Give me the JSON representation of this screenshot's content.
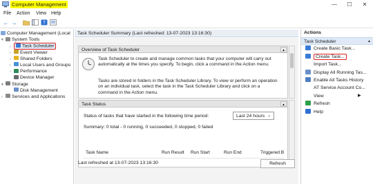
{
  "window": {
    "title": "Computer Management",
    "controls": [
      "—",
      "☐",
      "✕"
    ]
  },
  "menu": [
    "File",
    "Action",
    "View",
    "Help"
  ],
  "tree": {
    "root": "Computer Management (Local",
    "system_tools": "System Tools",
    "items": [
      {
        "label": "Task Scheduler",
        "icon": "task-scheduler-icon",
        "color": "#3a7bd5"
      },
      {
        "label": "Event Viewer",
        "icon": "event-viewer-icon",
        "color": "#c9a227"
      },
      {
        "label": "Shared Folders",
        "icon": "shared-folders-icon",
        "color": "#e6b422"
      },
      {
        "label": "Local Users and Groups",
        "icon": "users-icon",
        "color": "#4a90d9"
      },
      {
        "label": "Performance",
        "icon": "performance-icon",
        "color": "#2e8b57"
      },
      {
        "label": "Device Manager",
        "icon": "device-manager-icon",
        "color": "#6b6b6b"
      }
    ],
    "storage": "Storage",
    "disk_management": "Disk Management",
    "services": "Services and Applications"
  },
  "center": {
    "header": "Task Scheduler Summary (Last refreshed: 13-07-2023 13:16:30)",
    "overview_title": "Overview of Task Scheduler",
    "overview_text1": "Task Scheduler to create and manage common tasks that your computer will carry out automatically at the times you specify. To begin, click a command in the Action menu.",
    "overview_text2": "Tasks are stored in folders in the Task Scheduler Library. To view or perform an operation on an individual task, select the task in the Task Scheduler Library and click on a command in the Action menu.",
    "status_title": "Task Status",
    "status_label": "Status of tasks that have started in the following time period:",
    "status_select": "Last 24 hours",
    "summary": "Summary: 0 total - 0 running, 0 succeeded, 0 stopped, 0 failed",
    "columns": [
      "Task Name",
      "Run Result",
      "Run Start",
      "Run End",
      "Triggered B"
    ],
    "last_refreshed": "Last refreshed at 13-07-2023 13:16:30",
    "refresh": "Refresh"
  },
  "actions": {
    "header": "Actions",
    "section": "Task Scheduler",
    "items": [
      {
        "label": "Create Basic Task...",
        "icon": "create-basic-task-icon",
        "color": "#3a7bd5"
      },
      {
        "label": "Create Task...",
        "icon": "create-task-icon",
        "color": "#3a7bd5"
      },
      {
        "label": "Import Task...",
        "icon": "",
        "color": ""
      },
      {
        "label": "Display All Running Tas...",
        "icon": "running-tasks-icon",
        "color": "#6a8fc9"
      },
      {
        "label": "Enable All Tasks History",
        "icon": "history-icon",
        "color": "#4f7fc2"
      },
      {
        "label": "AT Service Account Co...",
        "icon": "",
        "color": ""
      },
      {
        "label": "View",
        "icon": "",
        "color": ""
      },
      {
        "label": "Refresh",
        "icon": "refresh-icon",
        "color": "#2e9e4a"
      },
      {
        "label": "Help",
        "icon": "help-icon",
        "color": "#2f6fd1"
      }
    ]
  }
}
